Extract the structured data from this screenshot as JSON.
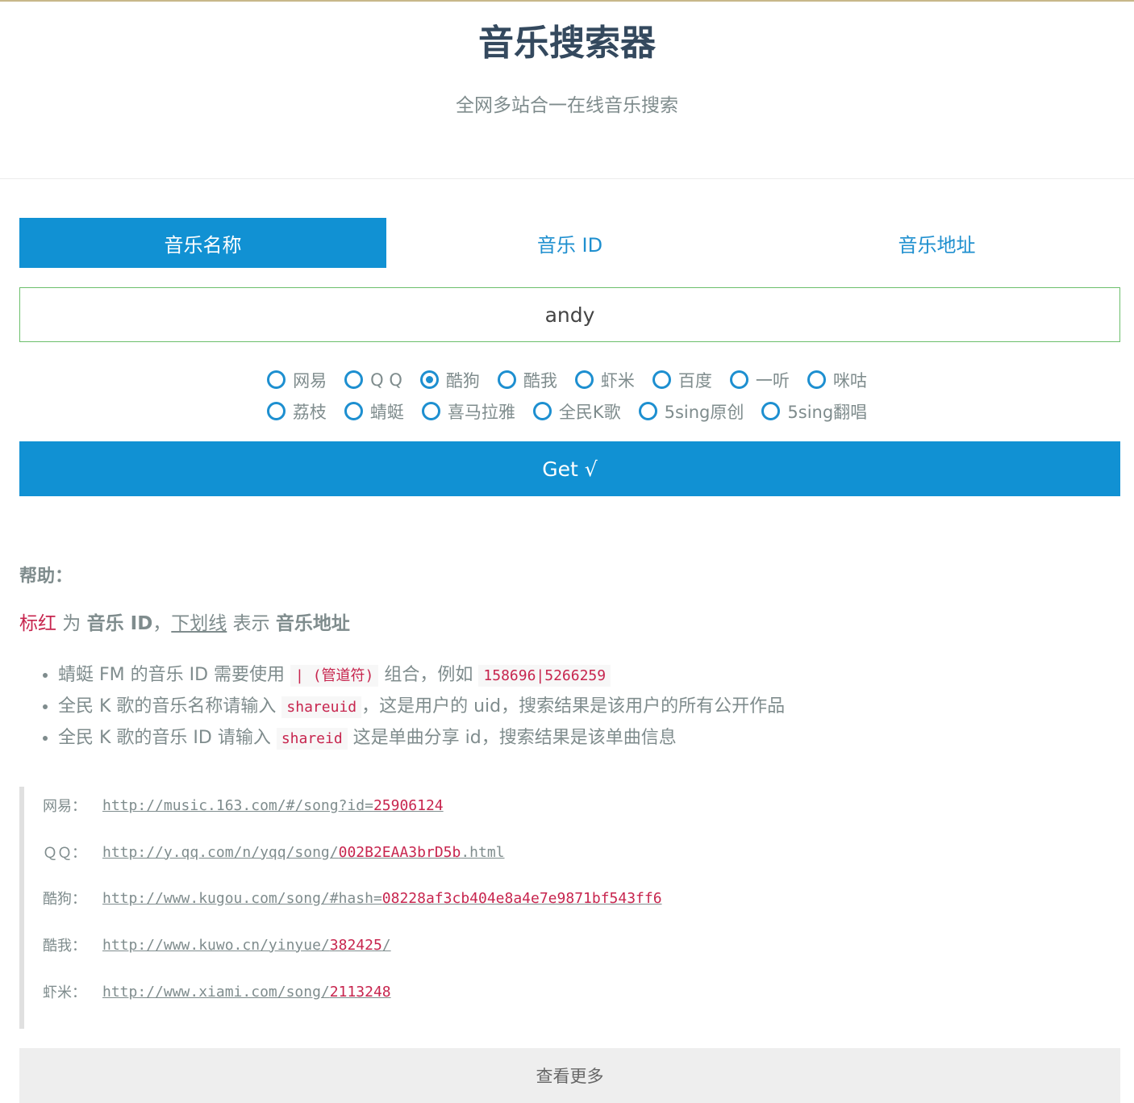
{
  "header": {
    "title": "音乐搜索器",
    "subtitle": "全网多站合一在线音乐搜索"
  },
  "tabs": [
    {
      "label": "音乐名称",
      "active": true
    },
    {
      "label": "音乐 ID",
      "active": false
    },
    {
      "label": "音乐地址",
      "active": false
    }
  ],
  "search": {
    "value": "andy"
  },
  "sources": {
    "row1": [
      {
        "label": "网易",
        "checked": false
      },
      {
        "label": "Q Q",
        "checked": false
      },
      {
        "label": "酷狗",
        "checked": true
      },
      {
        "label": "酷我",
        "checked": false
      },
      {
        "label": "虾米",
        "checked": false
      },
      {
        "label": "百度",
        "checked": false
      },
      {
        "label": "一听",
        "checked": false
      },
      {
        "label": "咪咕",
        "checked": false
      }
    ],
    "row2": [
      {
        "label": "荔枝",
        "checked": false
      },
      {
        "label": "蜻蜓",
        "checked": false
      },
      {
        "label": "喜马拉雅",
        "checked": false
      },
      {
        "label": "全民K歌",
        "checked": false
      },
      {
        "label": "5sing原创",
        "checked": false
      },
      {
        "label": "5sing翻唱",
        "checked": false
      }
    ]
  },
  "get_button": "Get √",
  "help": {
    "title": "帮助：",
    "legend": {
      "red_text": "标红",
      "is": " 为 ",
      "music_id": "音乐 ID",
      "comma": "，",
      "underline_text": "下划线",
      "means": " 表示 ",
      "music_url": "音乐地址"
    },
    "tips": [
      {
        "pre": "蜻蜓 FM 的音乐 ID 需要使用 ",
        "code1": "| (管道符)",
        "mid": " 组合，例如 ",
        "code2": "158696|5266259",
        "post": ""
      },
      {
        "pre": "全民 K 歌的音乐名称请输入 ",
        "code1": "shareuid",
        "mid": "，这是用户的 uid，搜索结果是该用户的所有公开作品",
        "code2": "",
        "post": ""
      },
      {
        "pre": "全民 K 歌的音乐 ID 请输入 ",
        "code1": "shareid",
        "mid": " 这是单曲分享 id，搜索结果是该单曲信息",
        "code2": "",
        "post": ""
      }
    ]
  },
  "examples": [
    {
      "label": "网易：",
      "url_prefix": "http://music.163.com/#/song?id=",
      "id": "25906124",
      "url_suffix": ""
    },
    {
      "label": "ＱＱ：",
      "url_prefix": "http://y.qq.com/n/yqq/song/",
      "id": "002B2EAA3brD5b",
      "url_suffix": ".html"
    },
    {
      "label": "酷狗：",
      "url_prefix": "http://www.kugou.com/song/#hash=",
      "id": "08228af3cb404e8a4e7e9871bf543ff6",
      "url_suffix": ""
    },
    {
      "label": "酷我：",
      "url_prefix": "http://www.kuwo.cn/yinyue/",
      "id": "382425",
      "url_suffix": "/"
    },
    {
      "label": "虾米：",
      "url_prefix": "http://www.xiami.com/song/",
      "id": "2113248",
      "url_suffix": ""
    }
  ],
  "more_button": "查看更多",
  "colors": {
    "accent": "#1191d3",
    "id_red": "#c7254e",
    "input_border": "#6cbf6c",
    "title": "#34495e"
  }
}
